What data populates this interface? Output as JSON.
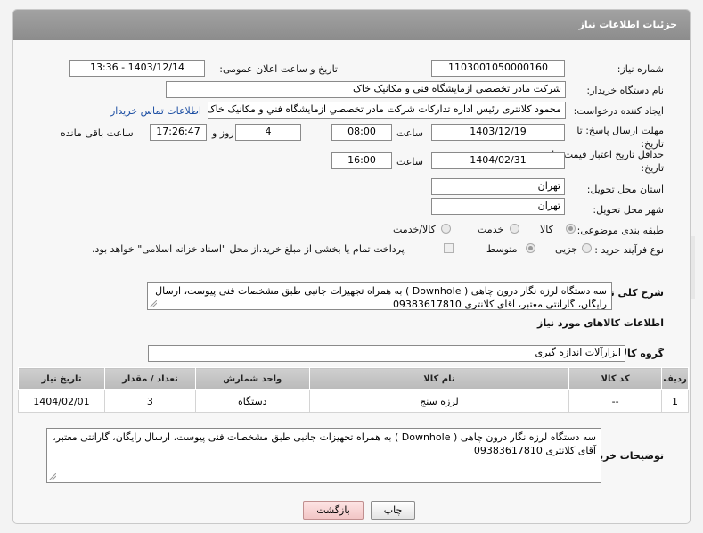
{
  "header": {
    "title": "جزئیات اطلاعات نیاز"
  },
  "fields": {
    "need_number_label": "شماره نیاز:",
    "need_number": "1103001050000160",
    "announce_label": "تاریخ و ساعت اعلان عمومی:",
    "announce_value": "1403/12/14 - 13:36",
    "buyer_org_label": "نام دستگاه خریدار:",
    "buyer_org": "شرکت مادر تخصصي ازمايشگاه فني و مکانيک خاک",
    "requester_label": "ایجاد کننده درخواست:",
    "requester": "محمود کلانتری رئیس اداره تدارکات شرکت مادر تخصصي ازمايشگاه فني و مکانيک خاک",
    "contact_link": "اطلاعات تماس خریدار",
    "reply_deadline_label_1": "مهلت ارسال پاسخ: تا",
    "reply_deadline_label_2": "تاریخ:",
    "reply_date": "1403/12/19",
    "time_label": "ساعت",
    "reply_time": "08:00",
    "days_value": "4",
    "days_label": "روز و",
    "remaining_time": "17:26:47",
    "remaining_label": "ساعت باقی مانده",
    "price_validity_label_1": "حداقل تاریخ اعتبار قیمت: تا",
    "price_validity_label_2": "تاریخ:",
    "price_date": "1404/02/31",
    "price_time": "16:00",
    "province_label": "استان محل تحویل:",
    "province": "تهران",
    "city_label": "شهر محل تحویل:",
    "city": "تهران",
    "category_label": "طبقه بندی موضوعی:",
    "category_options": [
      "کالا",
      "خدمت",
      "کالا/خدمت"
    ],
    "process_label": "نوع فرآیند خرید :",
    "process_options": [
      "جزیی",
      "متوسط"
    ],
    "payment_note": "پرداخت تمام یا بخشی از مبلغ خرید،از محل \"اسناد خزانه اسلامی\" خواهد بود."
  },
  "description": {
    "label": "شرح کلی نیاز:",
    "text": "سه دستگاه لرزه نگار درون چاهی ( Downhole ) به همراه تجهیزات جانبی طبق مشخصات فنی پیوست، ارسال رایگان، گارانتی معتبر، آقای کلانتری 09383617810"
  },
  "goods_section": {
    "title": "اطلاعات کالاهای مورد نیاز",
    "group_label": "گروه کالا:",
    "group_value": "ابزارآلات اندازه گیری"
  },
  "table": {
    "headers": [
      "ردیف",
      "کد کالا",
      "نام کالا",
      "واحد شمارش",
      "تعداد / مقدار",
      "تاریخ نیاز"
    ],
    "rows": [
      [
        "1",
        "--",
        "لرزه سنج",
        "دستگاه",
        "3",
        "1404/02/01"
      ]
    ]
  },
  "buyer_notes": {
    "label": "توضیحات خریدار:",
    "text": "سه دستگاه لرزه نگار درون چاهی ( Downhole ) به همراه تجهیزات جانبی طبق مشخصات فنی پیوست، ارسال رایگان، گارانتی معتبر، آقای کلانتری 09383617810"
  },
  "buttons": {
    "print": "چاپ",
    "back": "بازگشت"
  },
  "colors": {
    "header": "#999999",
    "link": "#1d4fa3",
    "back_button": "#f2c6c6"
  }
}
